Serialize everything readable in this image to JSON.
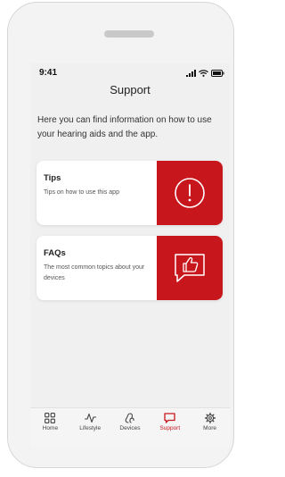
{
  "status_bar": {
    "time": "9:41"
  },
  "header": {
    "title": "Support"
  },
  "intro": {
    "text": "Here you can find information on how to use your hearing aids and the app."
  },
  "cards": [
    {
      "title": "Tips",
      "description": "Tips on how to use this app",
      "icon": "exclamation-circle-icon"
    },
    {
      "title": "FAQs",
      "description": "The most common topics about your devices",
      "icon": "thumbs-up-chat-icon"
    }
  ],
  "tabbar": {
    "active": "Support",
    "items": [
      {
        "label": "Home",
        "icon": "grid-icon"
      },
      {
        "label": "Lifestyle",
        "icon": "pulse-icon"
      },
      {
        "label": "Devices",
        "icon": "hearing-aids-icon"
      },
      {
        "label": "Support",
        "icon": "chat-bubble-icon"
      },
      {
        "label": "More",
        "icon": "gear-icon"
      }
    ]
  },
  "colors": {
    "accent": "#c8161d",
    "background": "#f0f0f0",
    "card": "#ffffff"
  }
}
